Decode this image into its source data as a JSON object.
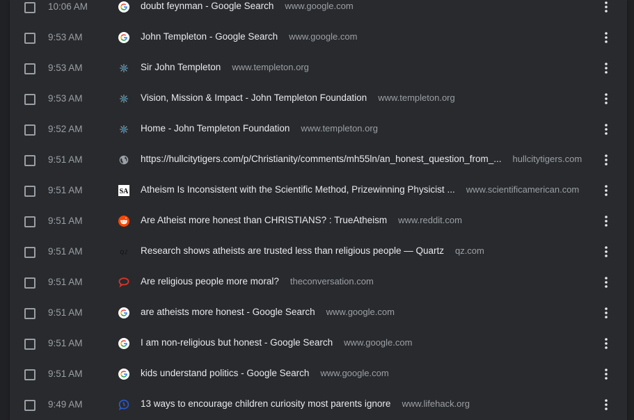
{
  "history": {
    "rows": [
      {
        "time": "10:06 AM",
        "title": "doubt feynman - Google Search",
        "domain": "www.google.com",
        "icon": "google-icon"
      },
      {
        "time": "9:53 AM",
        "title": "John Templeton - Google Search",
        "domain": "www.google.com",
        "icon": "google-icon"
      },
      {
        "time": "9:53 AM",
        "title": "Sir John Templeton",
        "domain": "www.templeton.org",
        "icon": "templeton-icon"
      },
      {
        "time": "9:53 AM",
        "title": "Vision, Mission & Impact - John Templeton Foundation",
        "domain": "www.templeton.org",
        "icon": "templeton-icon"
      },
      {
        "time": "9:52 AM",
        "title": "Home - John Templeton Foundation",
        "domain": "www.templeton.org",
        "icon": "templeton-icon"
      },
      {
        "time": "9:51 AM",
        "title": "https://hullcitytigers.com/p/Christianity/comments/mh55ln/an_honest_question_from_...",
        "domain": "hullcitytigers.com",
        "icon": "globe-icon"
      },
      {
        "time": "9:51 AM",
        "title": "Atheism Is Inconsistent with the Scientific Method, Prizewinning Physicist ...",
        "domain": "www.scientificamerican.com",
        "icon": "scientific-american-icon"
      },
      {
        "time": "9:51 AM",
        "title": "Are Atheist more honest than CHRISTIANS? : TrueAtheism",
        "domain": "www.reddit.com",
        "icon": "reddit-icon"
      },
      {
        "time": "9:51 AM",
        "title": "Research shows atheists are trusted less than religious people — Quartz",
        "domain": "qz.com",
        "icon": "quartz-icon"
      },
      {
        "time": "9:51 AM",
        "title": "Are religious people more moral?",
        "domain": "theconversation.com",
        "icon": "conversation-icon"
      },
      {
        "time": "9:51 AM",
        "title": "are atheists more honest - Google Search",
        "domain": "www.google.com",
        "icon": "google-icon"
      },
      {
        "time": "9:51 AM",
        "title": "I am non-religious but honest - Google Search",
        "domain": "www.google.com",
        "icon": "google-icon"
      },
      {
        "time": "9:51 AM",
        "title": "kids understand politics - Google Search",
        "domain": "www.google.com",
        "icon": "google-icon"
      },
      {
        "time": "9:49 AM",
        "title": "13 ways to encourage children curiosity most parents ignore",
        "domain": "www.lifehack.org",
        "icon": "lifehack-icon"
      }
    ],
    "sa_letters": "SA",
    "qz_letters": "QZ"
  },
  "colors": {
    "background": "#202124",
    "panel": "#292a2d",
    "title_text": "#e8eaed",
    "secondary_text": "#9aa0a6",
    "reddit": "#ff4500",
    "conversation": "#d8352a",
    "lifehack": "#2b57c9"
  }
}
